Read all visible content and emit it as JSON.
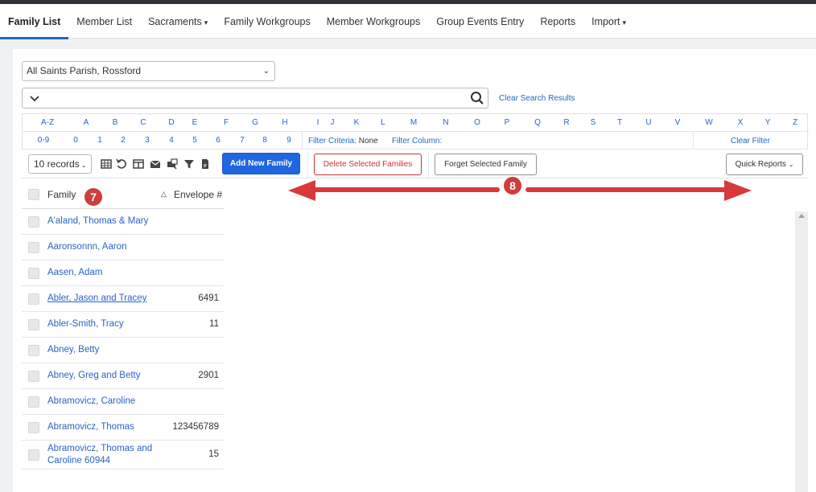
{
  "nav": {
    "items": [
      {
        "label": "Family List",
        "active": true,
        "caret": false,
        "w": 84
      },
      {
        "label": "Member List",
        "active": false,
        "caret": false,
        "w": 86
      },
      {
        "label": "Sacraments",
        "active": false,
        "caret": true,
        "w": 92
      },
      {
        "label": "Family Workgroups",
        "active": false,
        "caret": false,
        "w": 121
      },
      {
        "label": "Member Workgroups",
        "active": false,
        "caret": false,
        "w": 132
      },
      {
        "label": "Group Events Entry",
        "active": false,
        "caret": false,
        "w": 130
      },
      {
        "label": "Reports",
        "active": false,
        "caret": false,
        "w": 80
      },
      {
        "label": "Import",
        "active": false,
        "caret": true,
        "w": 70
      }
    ],
    "caret_glyph": "▾"
  },
  "parish_select": {
    "value": "All Saints Parish, Rossford"
  },
  "search": {
    "value": "",
    "clear_label": "Clear Search Results"
  },
  "alpha": {
    "row1": [
      "A-Z",
      "A",
      "B",
      "C",
      "D",
      "E",
      "F",
      "G",
      "H",
      "I",
      "J",
      "K",
      "L",
      "M",
      "N",
      "O",
      "P",
      "Q",
      "R",
      "S",
      "T",
      "U",
      "V",
      "W",
      "X",
      "Y",
      "Z"
    ],
    "row2": [
      "0-9",
      "0",
      "1",
      "2",
      "3",
      "4",
      "5",
      "6",
      "7",
      "8",
      "9"
    ],
    "filter_criteria_label": "Filter Criteria:",
    "filter_criteria_value": "None",
    "filter_column_label": "Filter Column:",
    "clear_filter_label": "Clear Filter"
  },
  "toolbar": {
    "records": "10 records",
    "add_label": "Add New Family",
    "delete_label": "Delete Selected Families",
    "forget_label": "Forget Selected Family",
    "quick_label": "Quick Reports"
  },
  "grid": {
    "col_family": "Family",
    "col_envelope": "Envelope #",
    "rows": [
      {
        "name": "A'aland, Thomas & Mary",
        "env": ""
      },
      {
        "name": "Aaronsonnn, Aaron",
        "env": ""
      },
      {
        "name": "Aasen, Adam",
        "env": ""
      },
      {
        "name": "Abler, Jason and Tracey",
        "env": "6491"
      },
      {
        "name": "Abler-Smith, Tracy",
        "env": "11"
      },
      {
        "name": "Abney, Betty",
        "env": ""
      },
      {
        "name": "Abney, Greg and Betty",
        "env": "2901"
      },
      {
        "name": "Abramovicz, Caroline",
        "env": ""
      },
      {
        "name": "Abramovicz, Thomas",
        "env": "123456789"
      },
      {
        "name": "Abramovicz, Thomas and Caroline 60944",
        "env": "15"
      }
    ]
  },
  "annotations": {
    "badge_7": "7",
    "badge_8": "8",
    "arrow_color": "#d9393a"
  }
}
